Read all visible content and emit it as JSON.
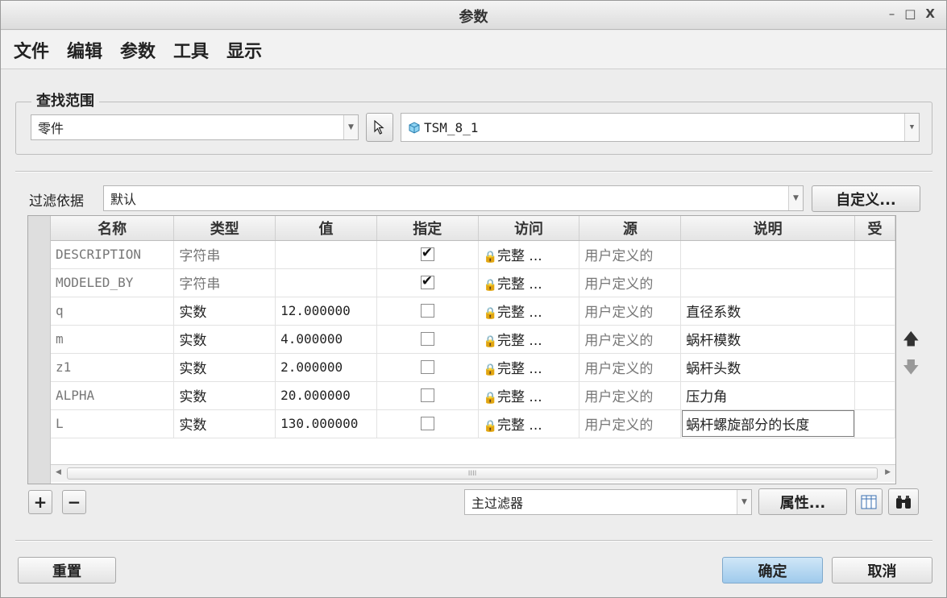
{
  "window": {
    "title": "参数",
    "min": "–",
    "max": "□",
    "close": "X"
  },
  "menu": [
    "文件",
    "编辑",
    "参数",
    "工具",
    "显示"
  ],
  "scope": {
    "legend": "查找范围",
    "type_value": "零件",
    "model_value": "TSM_8_1"
  },
  "filter": {
    "label": "过滤依据",
    "value": "默认",
    "customize": "自定义..."
  },
  "table": {
    "headers": [
      "名称",
      "类型",
      "值",
      "指定",
      "访问",
      "源",
      "说明",
      "受"
    ],
    "rows": [
      {
        "name": "DESCRIPTION",
        "type": "字符串",
        "value": "",
        "designate": true,
        "access": "完整",
        "source": "用户定义的",
        "desc": ""
      },
      {
        "name": "MODELED_BY",
        "type": "字符串",
        "value": "",
        "designate": true,
        "access": "完整",
        "source": "用户定义的",
        "desc": ""
      },
      {
        "name": "q",
        "type": "实数",
        "value": "12.000000",
        "designate": false,
        "access": "完整",
        "source": "用户定义的",
        "desc": "直径系数"
      },
      {
        "name": "m",
        "type": "实数",
        "value": "4.000000",
        "designate": false,
        "access": "完整",
        "source": "用户定义的",
        "desc": "蜗杆模数"
      },
      {
        "name": "z1",
        "type": "实数",
        "value": "2.000000",
        "designate": false,
        "access": "完整",
        "source": "用户定义的",
        "desc": "蜗杆头数"
      },
      {
        "name": "ALPHA",
        "type": "实数",
        "value": "20.000000",
        "designate": false,
        "access": "完整",
        "source": "用户定义的",
        "desc": "压力角"
      },
      {
        "name": "L",
        "type": "实数",
        "value": "130.000000",
        "designate": false,
        "access": "完整",
        "source": "用户定义的",
        "desc": "蜗杆螺旋部分的长度"
      }
    ],
    "access_more": "..."
  },
  "bottom_bar": {
    "add": "+",
    "remove": "−",
    "main_filter": "主过滤器",
    "properties": "属性..."
  },
  "footer": {
    "reset": "重置",
    "ok": "确定",
    "cancel": "取消"
  },
  "colors": {
    "primary_button": "#9fcaec",
    "window_bg": "#ededed"
  }
}
